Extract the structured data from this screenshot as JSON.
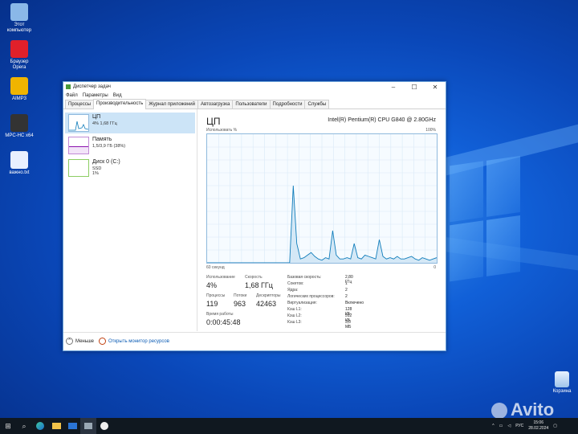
{
  "desktop": {
    "icons": [
      {
        "label": "Этот компьютер",
        "color": "#8ab8e8"
      },
      {
        "label": "Браузер Opera",
        "color": "#e0202a"
      },
      {
        "label": "AIMP3",
        "color": "#f0b400"
      },
      {
        "label": "MPC-HC x64",
        "color": "#333333"
      },
      {
        "label": "важно.txt",
        "color": "#e8f0ff"
      }
    ],
    "recycle_bin": "Корзина"
  },
  "taskmgr": {
    "title": "Диспетчер задач",
    "menu": [
      "Файл",
      "Параметры",
      "Вид"
    ],
    "tabs": [
      "Процессы",
      "Производительность",
      "Журнал приложений",
      "Автозагрузка",
      "Пользователи",
      "Подробности",
      "Службы"
    ],
    "active_tab": 1,
    "resources": [
      {
        "name": "ЦП",
        "value": "4% 1,68 ГГц",
        "color": "#117dbb"
      },
      {
        "name": "Память",
        "value": "1,5/3,9 ГБ (38%)",
        "color": "#8b12ae"
      },
      {
        "name": "Диск 0 (C:)",
        "value": "SSD",
        "value2": "1%",
        "color": "#4da60c"
      }
    ],
    "cpu": {
      "title": "ЦП",
      "model": "Intel(R) Pentium(R) CPU G840 @ 2.80GHz",
      "graph_label": "Использовать %",
      "graph_max": "100%",
      "graph_time": "60 секунд",
      "graph_min": "0",
      "usage_points": [
        0,
        0,
        0,
        0,
        0,
        0,
        0,
        0,
        0,
        0,
        0,
        0,
        0,
        0,
        0,
        0,
        0,
        0,
        0,
        0,
        0,
        0,
        0,
        0,
        60,
        15,
        3,
        4,
        6,
        8,
        5,
        3,
        2,
        4,
        3,
        25,
        6,
        3,
        3,
        4,
        3,
        15,
        4,
        3,
        6,
        5,
        4,
        3,
        18,
        5,
        3,
        4,
        3,
        5,
        3,
        3,
        4,
        5,
        3,
        2,
        4,
        3,
        2,
        3,
        4
      ],
      "stats": {
        "usage_label": "Использование",
        "usage": "4%",
        "speed_label": "Скорость",
        "speed": "1,68 ГГц",
        "proc_label": "Процессы",
        "proc": "119",
        "threads_label": "Потоки",
        "threads": "963",
        "handles_label": "Дескрипторы",
        "handles": "42463",
        "uptime_label": "Время работы",
        "uptime": "0:00:45:48"
      },
      "specs": [
        [
          "Базовая скорость:",
          "2,80 ГГц"
        ],
        [
          "Сокетов:",
          "1"
        ],
        [
          "Ядра:",
          "2"
        ],
        [
          "Логических процессоров:",
          "2"
        ],
        [
          "Виртуализация:",
          "Включено"
        ],
        [
          "Кэш L1:",
          "128 КБ"
        ],
        [
          "Кэш L2:",
          "512 КБ"
        ],
        [
          "Кэш L3:",
          "3,0 МБ"
        ]
      ]
    },
    "footer": {
      "less": "Меньше",
      "monitor": "Открыть монитор ресурсов"
    }
  },
  "taskbar": {
    "lang": "РУС",
    "time": "15:06",
    "date": "28.02.2024"
  },
  "watermark": "Avito"
}
